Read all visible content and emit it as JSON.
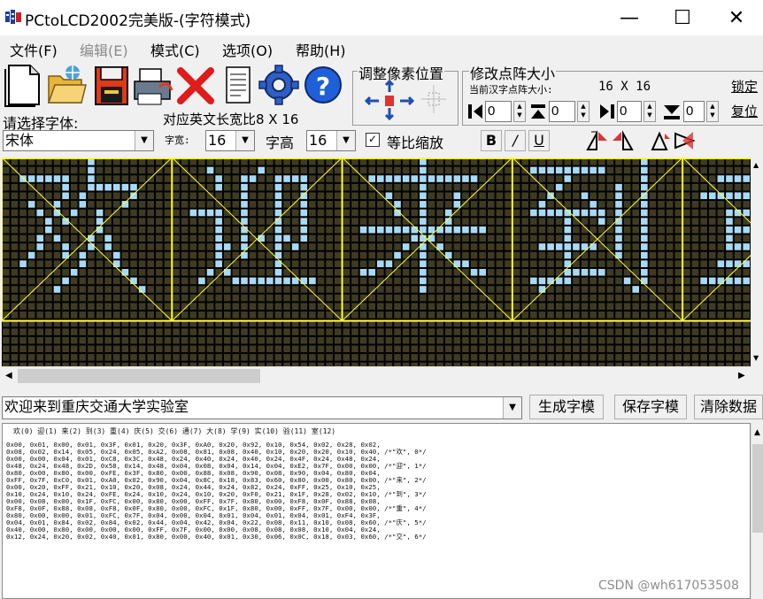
{
  "window": {
    "title": "PCtoLCD2002完美版-(字符模式)",
    "minimize": "—",
    "maximize": "☐",
    "close": "✕"
  },
  "menu": [
    {
      "label": "文件(F)",
      "enabled": true
    },
    {
      "label": "编辑(E)",
      "enabled": false
    },
    {
      "label": "模式(C)",
      "enabled": true
    },
    {
      "label": "选项(O)",
      "enabled": true
    },
    {
      "label": "帮助(H)",
      "enabled": true
    }
  ],
  "toolbar": {
    "icons": [
      "new-file-icon",
      "open-folder-icon",
      "save-disk-icon",
      "print-icon",
      "delete-x-icon",
      "notepad-icon",
      "settings-gear-icon",
      "help-icon"
    ]
  },
  "pixel_adjust": {
    "legend": "调整像素位置"
  },
  "dot_matrix": {
    "legend": "修改点阵大小",
    "current_size_label": "当前汉字点阵大小:",
    "current_size_value": "16 X 16",
    "spin_values": [
      "0",
      "0",
      "0",
      "0"
    ],
    "lock_button": "锁定",
    "reset_button": "复位"
  },
  "font": {
    "choose_label": "请选择字体:",
    "english_size_label": "对应英文长宽比8 X 16",
    "font_name": "宋体",
    "width_label": "字宽:",
    "width_value": "16",
    "height_label": "字高",
    "height_value": "16",
    "proportional_checked": true,
    "proportional_label": "等比缩放",
    "bold": "B",
    "italic": "/",
    "underline": "U"
  },
  "grid": {
    "cols": 96,
    "rows": 26,
    "on_color": "#a9daf5",
    "off_color": "#3f3b23",
    "line_color": "#000000",
    "guide_color": "#ffff3c"
  },
  "input": {
    "text": "欢迎来到重庆交通大学实验室",
    "generate_button": "生成字模",
    "save_button": "保存字模",
    "clear_button": "清除数据"
  },
  "output": {
    "legend_line": "欢(0) 迎(1) 来(2) 到(3) 重(4) 庆(5) 交(6) 通(7) 大(8) 学(9) 实(10) 验(11) 室(12)",
    "lines": [
      "0x00, 0x01, 0x00, 0x01, 0x3F, 0x01, 0x20, 0x3F, 0xA0, 0x20, 0x92, 0x10, 0x54, 0x02, 0x28, 0x02,",
      "0x08, 0x02, 0x14, 0x05, 0x24, 0x05, 0xA2, 0x08, 0x81, 0x08, 0x40, 0x10, 0x20, 0x20, 0x10, 0x40, /*\"欢\", 0*/",
      "0x00, 0x00, 0x04, 0x01, 0xC8, 0x3C, 0x48, 0x24, 0x40, 0x24, 0x40, 0x24, 0x4F, 0x24, 0x48, 0x24,",
      "0x48, 0x24, 0x48, 0x2D, 0x58, 0x14, 0x48, 0x04, 0x08, 0x04, 0x14, 0x04, 0xE2, 0x7F, 0x00, 0x00, /*\"迎\", 1*/",
      "0x80, 0x00, 0x80, 0x00, 0xFE, 0x3F, 0x80, 0x00, 0x88, 0x08, 0x90, 0x08, 0x90, 0x04, 0x80, 0x04,",
      "0xFF, 0x7F, 0xC0, 0x01, 0xA0, 0x02, 0x90, 0x04, 0x8C, 0x18, 0x83, 0x60, 0x80, 0x00, 0x80, 0x00, /*\"来\", 2*/",
      "0x00, 0x20, 0xFF, 0x21, 0x10, 0x20, 0x08, 0x24, 0x44, 0x24, 0x82, 0x24, 0xFF, 0x25, 0x10, 0x25,",
      "0x10, 0x24, 0x10, 0x24, 0xFE, 0x24, 0x10, 0x24, 0x10, 0x20, 0xF0, 0x21, 0x1F, 0x28, 0x02, 0x10, /*\"到\", 3*/",
      "0x00, 0x08, 0x00, 0x1F, 0xFC, 0x00, 0x80, 0x00, 0xFF, 0x7F, 0x80, 0x00, 0xF8, 0x0F, 0x88, 0x08,",
      "0xF8, 0x0F, 0x88, 0x08, 0xF8, 0x0F, 0x80, 0x00, 0xFC, 0x1F, 0x80, 0x00, 0xFF, 0x7F, 0x00, 0x00, /*\"重\", 4*/",
      "0x80, 0x00, 0x00, 0x01, 0xFC, 0x7F, 0x04, 0x00, 0x04, 0x01, 0x04, 0x01, 0x04, 0x01, 0xF4, 0x3F,",
      "0x04, 0x01, 0x84, 0x02, 0x84, 0x02, 0x44, 0x04, 0x42, 0x04, 0x22, 0x08, 0x11, 0x10, 0x08, 0x60, /*\"庆\", 5*/",
      "0x40, 0x00, 0x80, 0x00, 0x00, 0x00, 0xFF, 0x7F, 0x00, 0x00, 0x08, 0x08, 0x08, 0x10, 0x04, 0x24,",
      "0x12, 0x24, 0x20, 0x02, 0x40, 0x01, 0x80, 0x00, 0x40, 0x01, 0x30, 0x06, 0x0C, 0x18, 0x03, 0x60, /*\"交\", 6*/"
    ]
  },
  "watermark": "CSDN @wh617053508"
}
